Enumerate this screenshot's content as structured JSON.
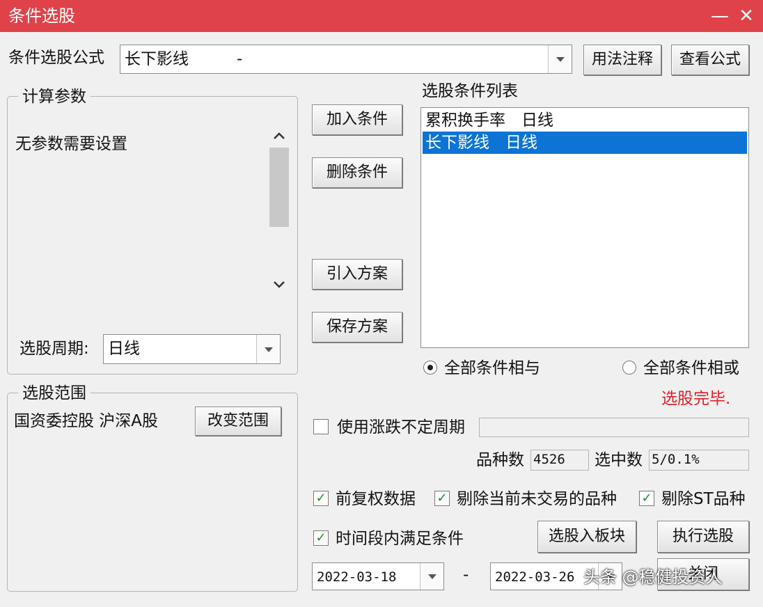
{
  "window": {
    "title": "条件选股",
    "minimize_glyph": "—",
    "close_glyph": "✕"
  },
  "formula": {
    "label": "条件选股公式",
    "value": "长下影线　　　-",
    "usage_button": "用法注释",
    "view_button": "查看公式"
  },
  "params": {
    "title": "计算参数",
    "message": "无参数需要设置",
    "period_label": "选股周期:",
    "period_value": "日线"
  },
  "range": {
    "title": "选股范围",
    "value": "国资委控股  沪深A股",
    "change_button": "改变范围"
  },
  "actions": {
    "add": "加入条件",
    "delete": "删除条件",
    "import": "引入方案",
    "save": "保存方案"
  },
  "conditions": {
    "title": "选股条件列表",
    "items": [
      {
        "text": "累积换手率　日线",
        "selected": false
      },
      {
        "text": "长下影线　日线",
        "selected": true
      }
    ],
    "radio_and": "全部条件相与",
    "radio_or": "全部条件相或",
    "status": "选股完毕.",
    "status_color": "#e0202a"
  },
  "options": {
    "variable_period": "使用涨跌不定周期",
    "variety_count_label": "品种数",
    "variety_count": "4526",
    "selected_count_label": "选中数",
    "selected_count": "5/0.1%",
    "adjust": "前复权数据",
    "exclude_untraded": "剔除当前未交易的品种",
    "exclude_st": "剔除ST品种",
    "time_range": "时间段内满足条件",
    "check_glyph": "✓"
  },
  "buttons": {
    "to_block": "选股入板块",
    "execute": "执行选股",
    "close": "关闭"
  },
  "dates": {
    "start": "2022-03-18",
    "separator": "-",
    "end": "2022-03-26"
  },
  "watermark": "头条 @稳健投资人",
  "colors": {
    "titlebar": "#e0424a",
    "selection": "#0d74d6",
    "check": "#198c2c"
  }
}
